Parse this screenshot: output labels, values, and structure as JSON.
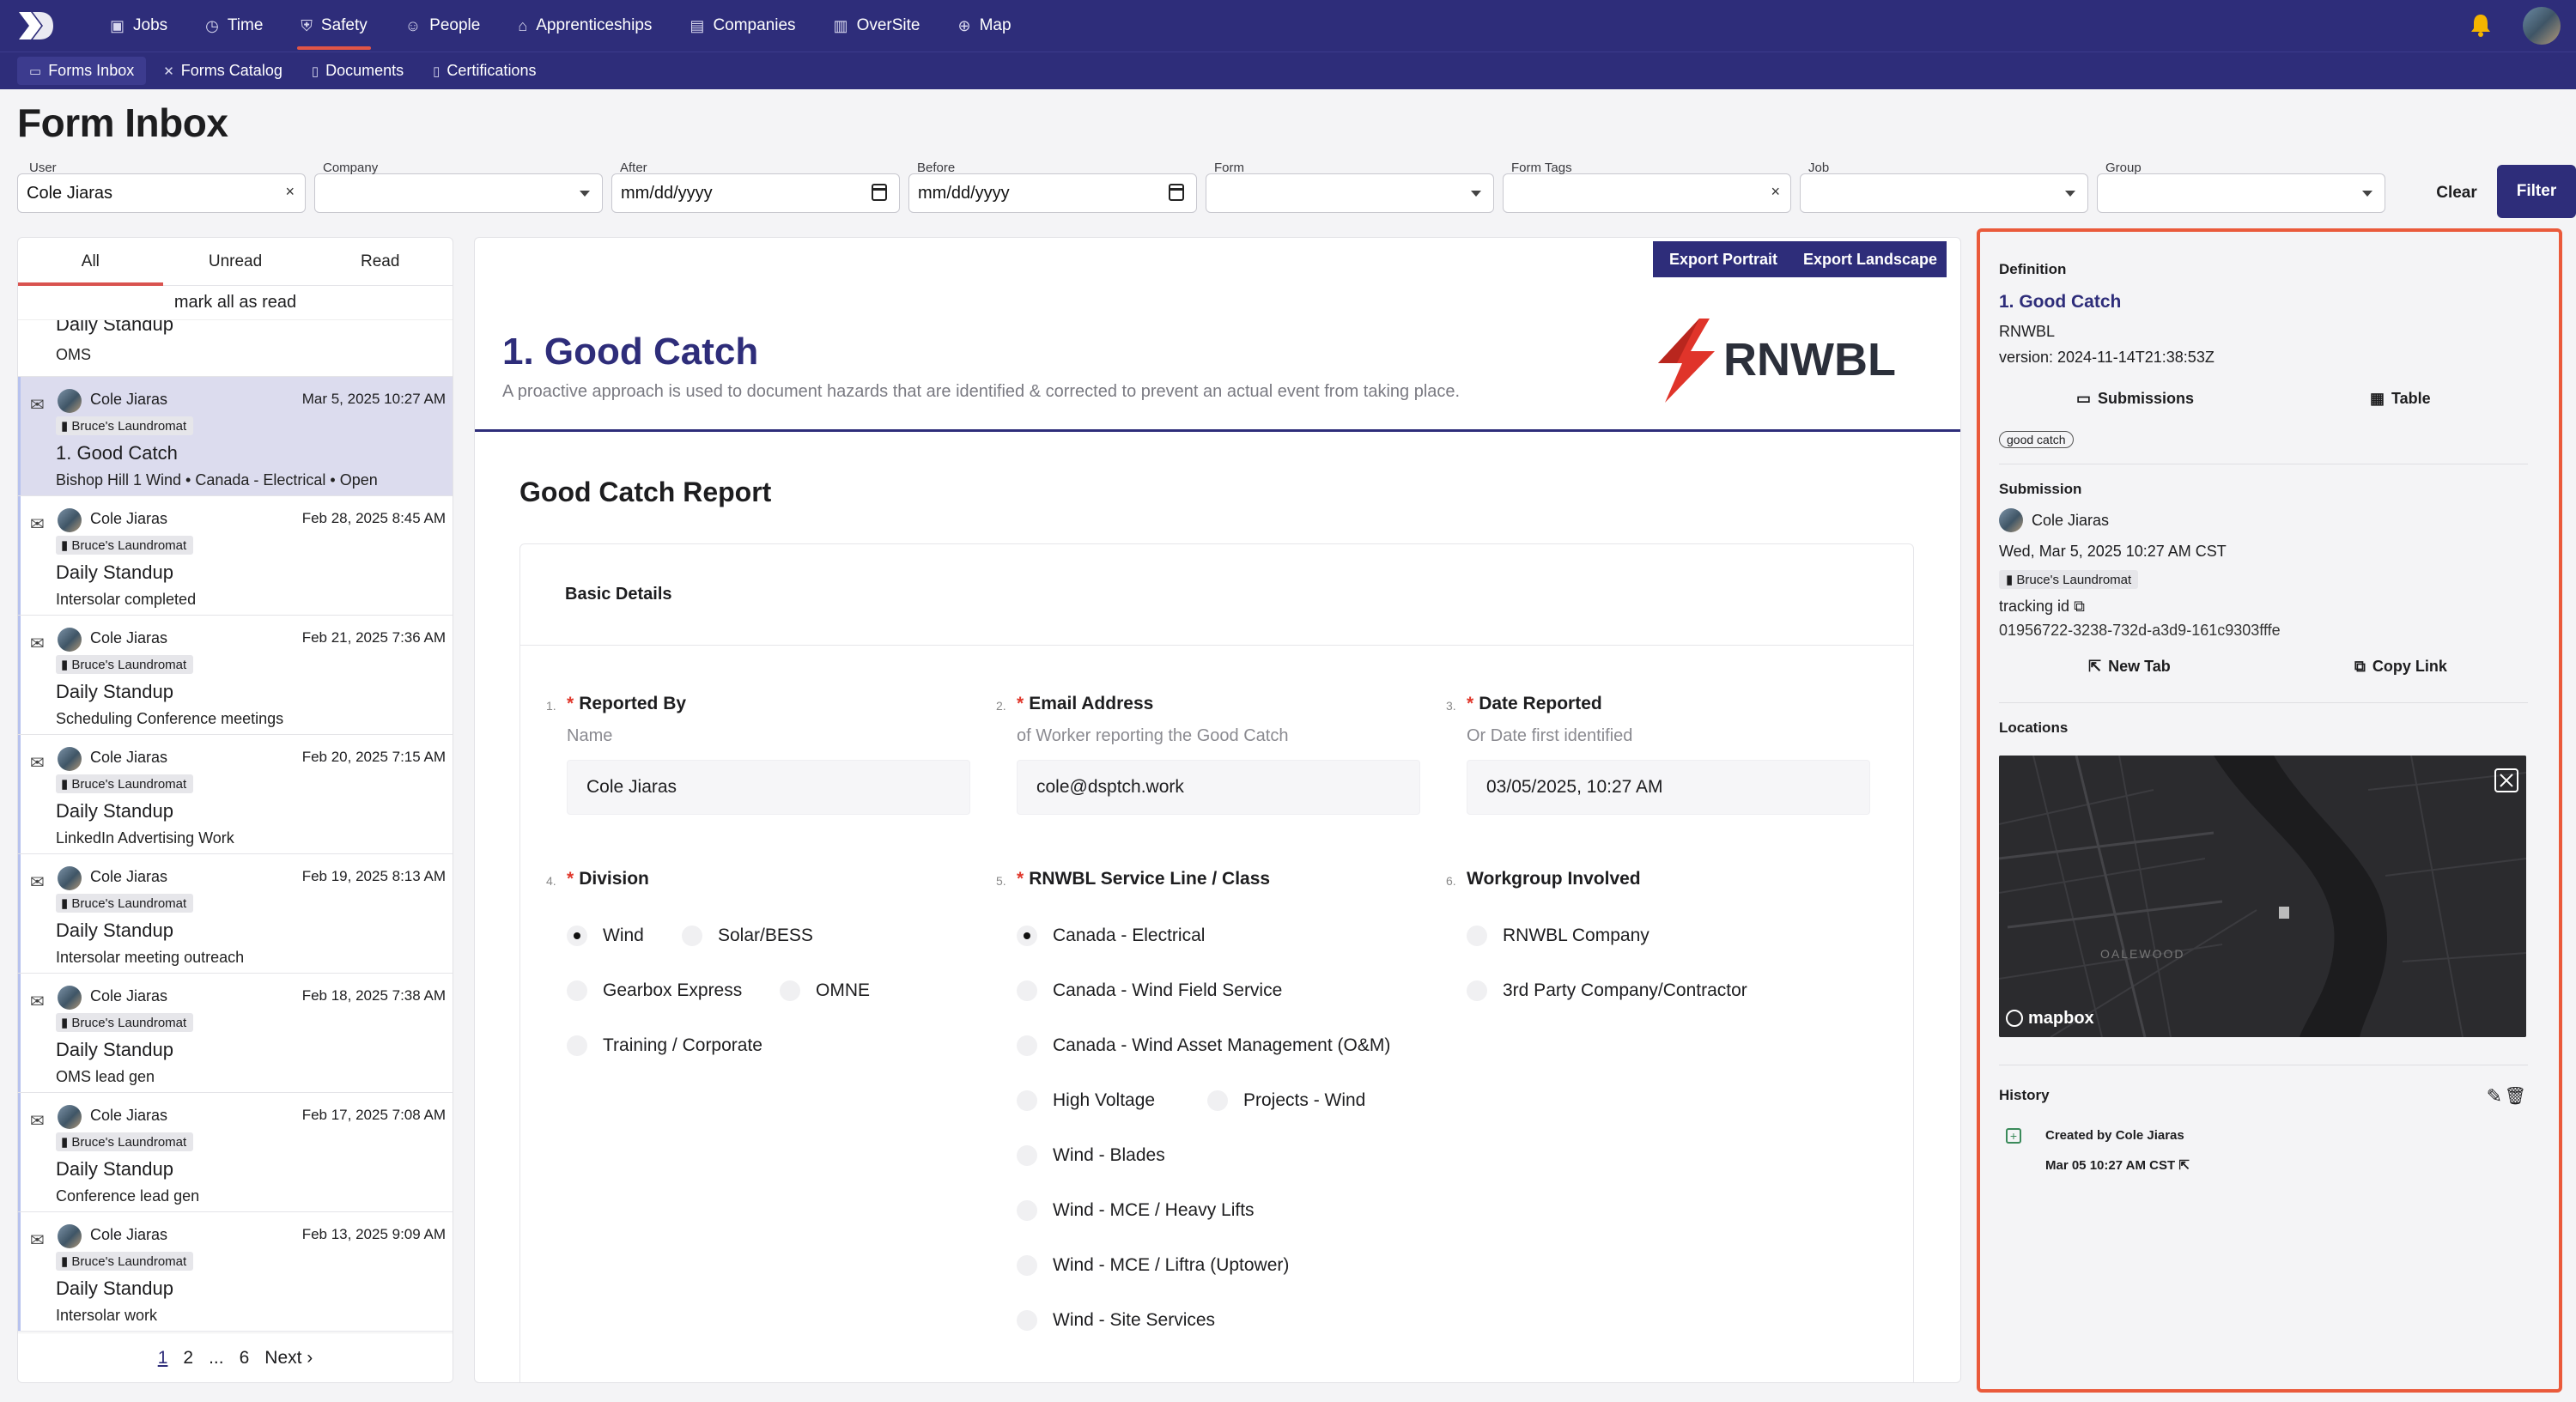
{
  "nav": {
    "items": [
      {
        "label": "Jobs",
        "icon": "briefcase-icon",
        "glyph": "▣"
      },
      {
        "label": "Time",
        "icon": "clock-icon",
        "glyph": "◷"
      },
      {
        "label": "Safety",
        "icon": "shield-icon",
        "glyph": "⛨"
      },
      {
        "label": "People",
        "icon": "people-icon",
        "glyph": "☺"
      },
      {
        "label": "Apprenticeships",
        "icon": "graduation-cap-icon",
        "glyph": "⌂"
      },
      {
        "label": "Companies",
        "icon": "building-icon",
        "glyph": "▤"
      },
      {
        "label": "OverSite",
        "icon": "map-fold-icon",
        "glyph": "▥"
      },
      {
        "label": "Map",
        "icon": "globe-icon",
        "glyph": "⊕"
      }
    ],
    "active": "Safety"
  },
  "subnav": {
    "items": [
      {
        "label": "Forms Inbox",
        "icon": "inbox-icon",
        "glyph": "▭"
      },
      {
        "label": "Forms Catalog",
        "icon": "tools-icon",
        "glyph": "✕"
      },
      {
        "label": "Documents",
        "icon": "document-icon",
        "glyph": "▯"
      },
      {
        "label": "Certifications",
        "icon": "certificate-icon",
        "glyph": "▯"
      }
    ]
  },
  "page": {
    "title": "Form Inbox"
  },
  "filters": {
    "user_label": "User",
    "user_value": "Cole Jiaras",
    "company_label": "Company",
    "after_label": "After",
    "after_value": "mm/dd/yyyy",
    "before_label": "Before",
    "before_value": "mm/dd/yyyy",
    "form_label": "Form",
    "tags_label": "Form Tags",
    "job_label": "Job",
    "group_label": "Group",
    "clear": "Clear",
    "filter": "Filter"
  },
  "inbox": {
    "tabs": [
      "All",
      "Unread",
      "Read"
    ],
    "mark_all": "mark all as read",
    "partial": {
      "title": "Daily Standup",
      "sub": "OMS"
    },
    "items": [
      {
        "user": "Cole Jiaras",
        "date": "Mar 5, 2025 10:27 AM",
        "company": "Bruce's Laundromat",
        "title": "1. Good Catch",
        "sub": "Bishop Hill 1 Wind • Canada - Electrical • Open"
      },
      {
        "user": "Cole Jiaras",
        "date": "Feb 28, 2025 8:45 AM",
        "company": "Bruce's Laundromat",
        "title": "Daily Standup",
        "sub": "Intersolar completed"
      },
      {
        "user": "Cole Jiaras",
        "date": "Feb 21, 2025 7:36 AM",
        "company": "Bruce's Laundromat",
        "title": "Daily Standup",
        "sub": "Scheduling Conference meetings"
      },
      {
        "user": "Cole Jiaras",
        "date": "Feb 20, 2025 7:15 AM",
        "company": "Bruce's Laundromat",
        "title": "Daily Standup",
        "sub": "LinkedIn Advertising Work"
      },
      {
        "user": "Cole Jiaras",
        "date": "Feb 19, 2025 8:13 AM",
        "company": "Bruce's Laundromat",
        "title": "Daily Standup",
        "sub": "Intersolar meeting outreach"
      },
      {
        "user": "Cole Jiaras",
        "date": "Feb 18, 2025 7:38 AM",
        "company": "Bruce's Laundromat",
        "title": "Daily Standup",
        "sub": "OMS lead gen"
      },
      {
        "user": "Cole Jiaras",
        "date": "Feb 17, 2025 7:08 AM",
        "company": "Bruce's Laundromat",
        "title": "Daily Standup",
        "sub": "Conference lead gen"
      },
      {
        "user": "Cole Jiaras",
        "date": "Feb 13, 2025 9:09 AM",
        "company": "Bruce's Laundromat",
        "title": "Daily Standup",
        "sub": "Intersolar work"
      }
    ],
    "pager": {
      "p1": "1",
      "p2": "2",
      "ellipsis": "...",
      "p6": "6",
      "next": "Next ›"
    }
  },
  "form": {
    "export_portrait": "Export Portrait",
    "export_landscape": "Export Landscape",
    "title": "1. Good Catch",
    "description": "A proactive approach is used to document hazards that are identified & corrected to prevent an actual event from taking place.",
    "brand": "RNWBL",
    "report_title": "Good Catch Report",
    "section": "Basic Details",
    "questions": [
      {
        "num": "1.",
        "label": "Reported By",
        "hint": "Name",
        "value": "Cole Jiaras",
        "required": "*"
      },
      {
        "num": "2.",
        "label": "Email Address",
        "hint": "of Worker reporting the Good Catch",
        "value": "cole@dsptch.work",
        "required": "*"
      },
      {
        "num": "3.",
        "label": "Date Reported",
        "hint": "Or Date first identified",
        "value": "03/05/2025, 10:27 AM",
        "required": "*"
      },
      {
        "num": "4.",
        "label": "Division",
        "required": "*"
      },
      {
        "num": "5.",
        "label": "RNWBL Service Line / Class",
        "required": "*"
      },
      {
        "num": "6.",
        "label": "Workgroup Involved"
      }
    ],
    "division": [
      "Wind",
      "Solar/BESS",
      "Gearbox Express",
      "OMNE",
      "Training / Corporate"
    ],
    "service": [
      "Canada - Electrical",
      "Canada - Wind Field Service",
      "Canada - Wind Asset Management (O&M)",
      "High Voltage",
      "Projects - Wind",
      "Wind - Blades",
      "Wind - MCE / Heavy Lifts",
      "Wind - MCE / Liftra (Uptower)",
      "Wind - Site Services"
    ],
    "workgroup": [
      "RNWBL Company",
      "3rd Party Company/Contractor"
    ],
    "selected": {
      "division": "Wind",
      "service": "Canada - Electrical"
    }
  },
  "sidebar": {
    "definition_label": "Definition",
    "def_title": "1. Good Catch",
    "def_org": "RNWBL",
    "def_version": "version: 2024-11-14T21:38:53Z",
    "submissions": "Submissions",
    "table": "Table",
    "tag": "good catch",
    "submission_label": "Submission",
    "sub_user": "Cole Jiaras",
    "sub_date": "Wed, Mar 5, 2025 10:27 AM CST",
    "sub_company": "Bruce's Laundromat",
    "tracking_label": "tracking id",
    "tracking_id": "01956722-3238-732d-a3d9-161c9303fffe",
    "new_tab": "New Tab",
    "copy_link": "Copy Link",
    "locations_label": "Locations",
    "map_place": "OALEWOOD",
    "map_brand": "mapbox",
    "history_label": "History",
    "history_created": "Created by Cole Jiaras",
    "history_date": "Mar 05 10:27 AM CST"
  },
  "colors": {
    "brand": "#2e2d7a",
    "accent": "#e25546",
    "highlight": "#ea5a3b"
  }
}
